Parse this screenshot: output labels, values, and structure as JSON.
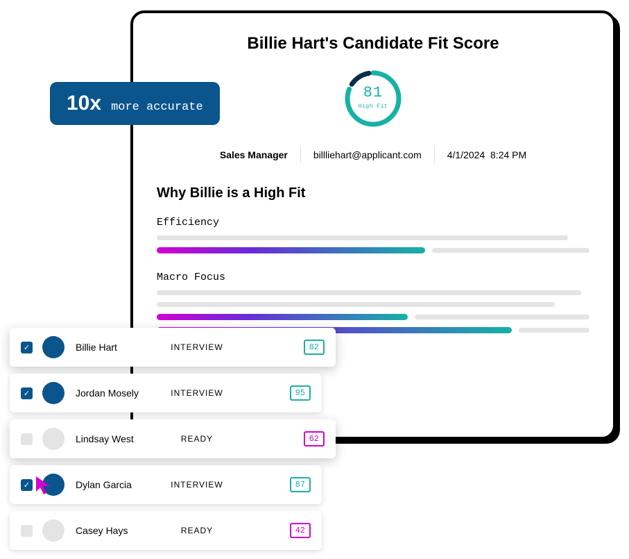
{
  "card": {
    "title": "Billie Hart's Candidate Fit Score",
    "score": "81",
    "score_label": "High Fit",
    "role": "Sales Manager",
    "email": "billliehart@applicant.com",
    "date": "4/1/2024",
    "time": "8:24 PM",
    "why_heading": "Why Billie is a High Fit",
    "metrics": [
      {
        "name": "Efficiency",
        "value": 62
      },
      {
        "name": "Macro Focus",
        "value": 58
      }
    ]
  },
  "badge": {
    "big": "10x",
    "text": "more accurate"
  },
  "candidates": [
    {
      "name": "Billie Hart",
      "status": "INTERVIEW",
      "score": "82",
      "checked": true,
      "color": "teal",
      "hot": true
    },
    {
      "name": "Jordan Mosely",
      "status": "INTERVIEW",
      "score": "95",
      "checked": true,
      "color": "teal",
      "hot": false
    },
    {
      "name": "Lindsay West",
      "status": "READY",
      "score": "62",
      "checked": false,
      "color": "mag",
      "hot": true
    },
    {
      "name": "Dylan Garcia",
      "status": "INTERVIEW",
      "score": "87",
      "checked": true,
      "color": "teal",
      "hot": false
    },
    {
      "name": "Casey Hays",
      "status": "READY",
      "score": "42",
      "checked": false,
      "color": "mag",
      "hot": false
    }
  ],
  "chart_data": {
    "type": "bar",
    "title": "Why Billie is a High Fit",
    "categories": [
      "Efficiency",
      "Macro Focus"
    ],
    "values": [
      62,
      58
    ],
    "ylim": [
      0,
      100
    ],
    "gauge": {
      "value": 81,
      "max": 100,
      "label": "High Fit"
    }
  }
}
